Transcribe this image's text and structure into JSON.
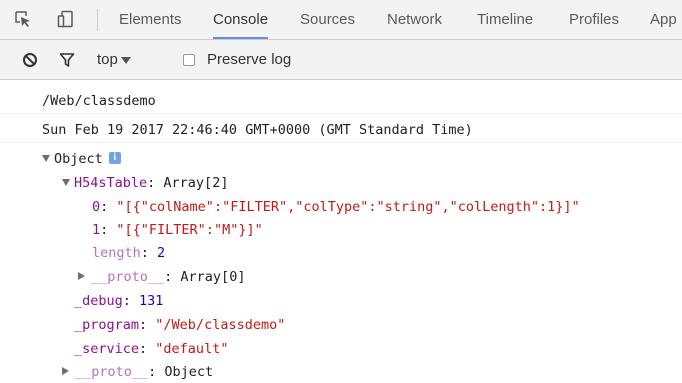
{
  "tabbar": {
    "tabs": [
      "Elements",
      "Console",
      "Sources",
      "Network",
      "Timeline",
      "Profiles",
      "App"
    ],
    "active_tab": "Console"
  },
  "console_toolbar": {
    "context": "top",
    "preserve_log_label": "Preserve log",
    "preserve_log_checked": false
  },
  "console": {
    "log_path": "/Web/classdemo",
    "log_date": "Sun Feb 19 2017 22:46:40 GMT+0000 (GMT Standard Time)",
    "object_label": "Object",
    "info_badge": "i",
    "table_key": "H54sTable",
    "table_type": "Array[2]",
    "item0_key": "0",
    "item0_value": "\"[{\"colName\":\"FILTER\",\"colType\":\"string\",\"colLength\":1}]\"",
    "item1_key": "1",
    "item1_value": "\"[{\"FILTER\":\"M\"}]\"",
    "length_key": "length",
    "length_value": "2",
    "table_proto_key": "__proto__",
    "table_proto_value": "Array[0]",
    "debug_key": "_debug",
    "debug_value": "131",
    "program_key": "_program",
    "program_value": "\"/Web/classdemo\"",
    "service_key": "_service",
    "service_value": "\"default\"",
    "object_proto_key": "__proto__",
    "object_proto_value": "Object"
  },
  "colors": {
    "active_tab_underline": "#6b8de0",
    "property_key": "#881391",
    "string_value": "#c41a16",
    "number_value": "#1c00cf"
  }
}
